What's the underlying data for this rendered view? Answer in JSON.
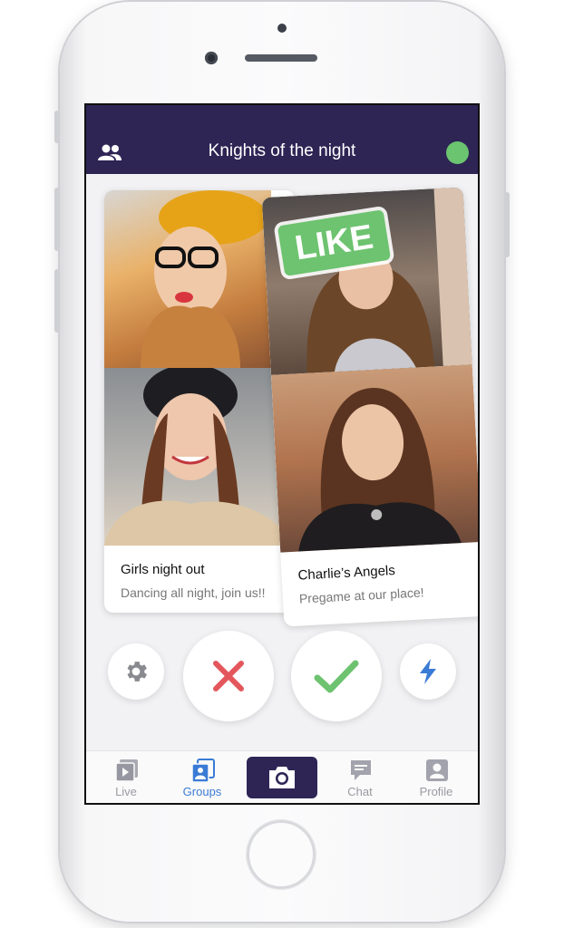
{
  "header": {
    "title": "Knights of the night",
    "left_icon": "group-icon",
    "status_color": "#6bc46f"
  },
  "cards": [
    {
      "title": "Girls night out",
      "subtitle": "Dancing all night, join us!!"
    },
    {
      "title": "Charlie’s Angels",
      "subtitle": "Pregame at our place!",
      "stamp": "LIKE"
    }
  ],
  "actions": [
    {
      "name": "settings",
      "icon": "gear-icon"
    },
    {
      "name": "dislike",
      "icon": "close-icon",
      "color": "#e3575c"
    },
    {
      "name": "like",
      "icon": "check-icon",
      "color": "#6dc36f"
    },
    {
      "name": "boost",
      "icon": "lightning-icon",
      "color": "#3a7bd5"
    }
  ],
  "tabs": [
    {
      "label": "Live",
      "icon": "video-icon"
    },
    {
      "label": "Groups",
      "icon": "groups-icon",
      "active": true
    },
    {
      "label": "",
      "icon": "camera-icon"
    },
    {
      "label": "Chat",
      "icon": "chat-icon"
    },
    {
      "label": "Profile",
      "icon": "profile-icon"
    }
  ],
  "colors": {
    "brand": "#2e2555",
    "accent": "#3a7bd5",
    "like": "#6dc36f",
    "nope": "#e3575c"
  }
}
